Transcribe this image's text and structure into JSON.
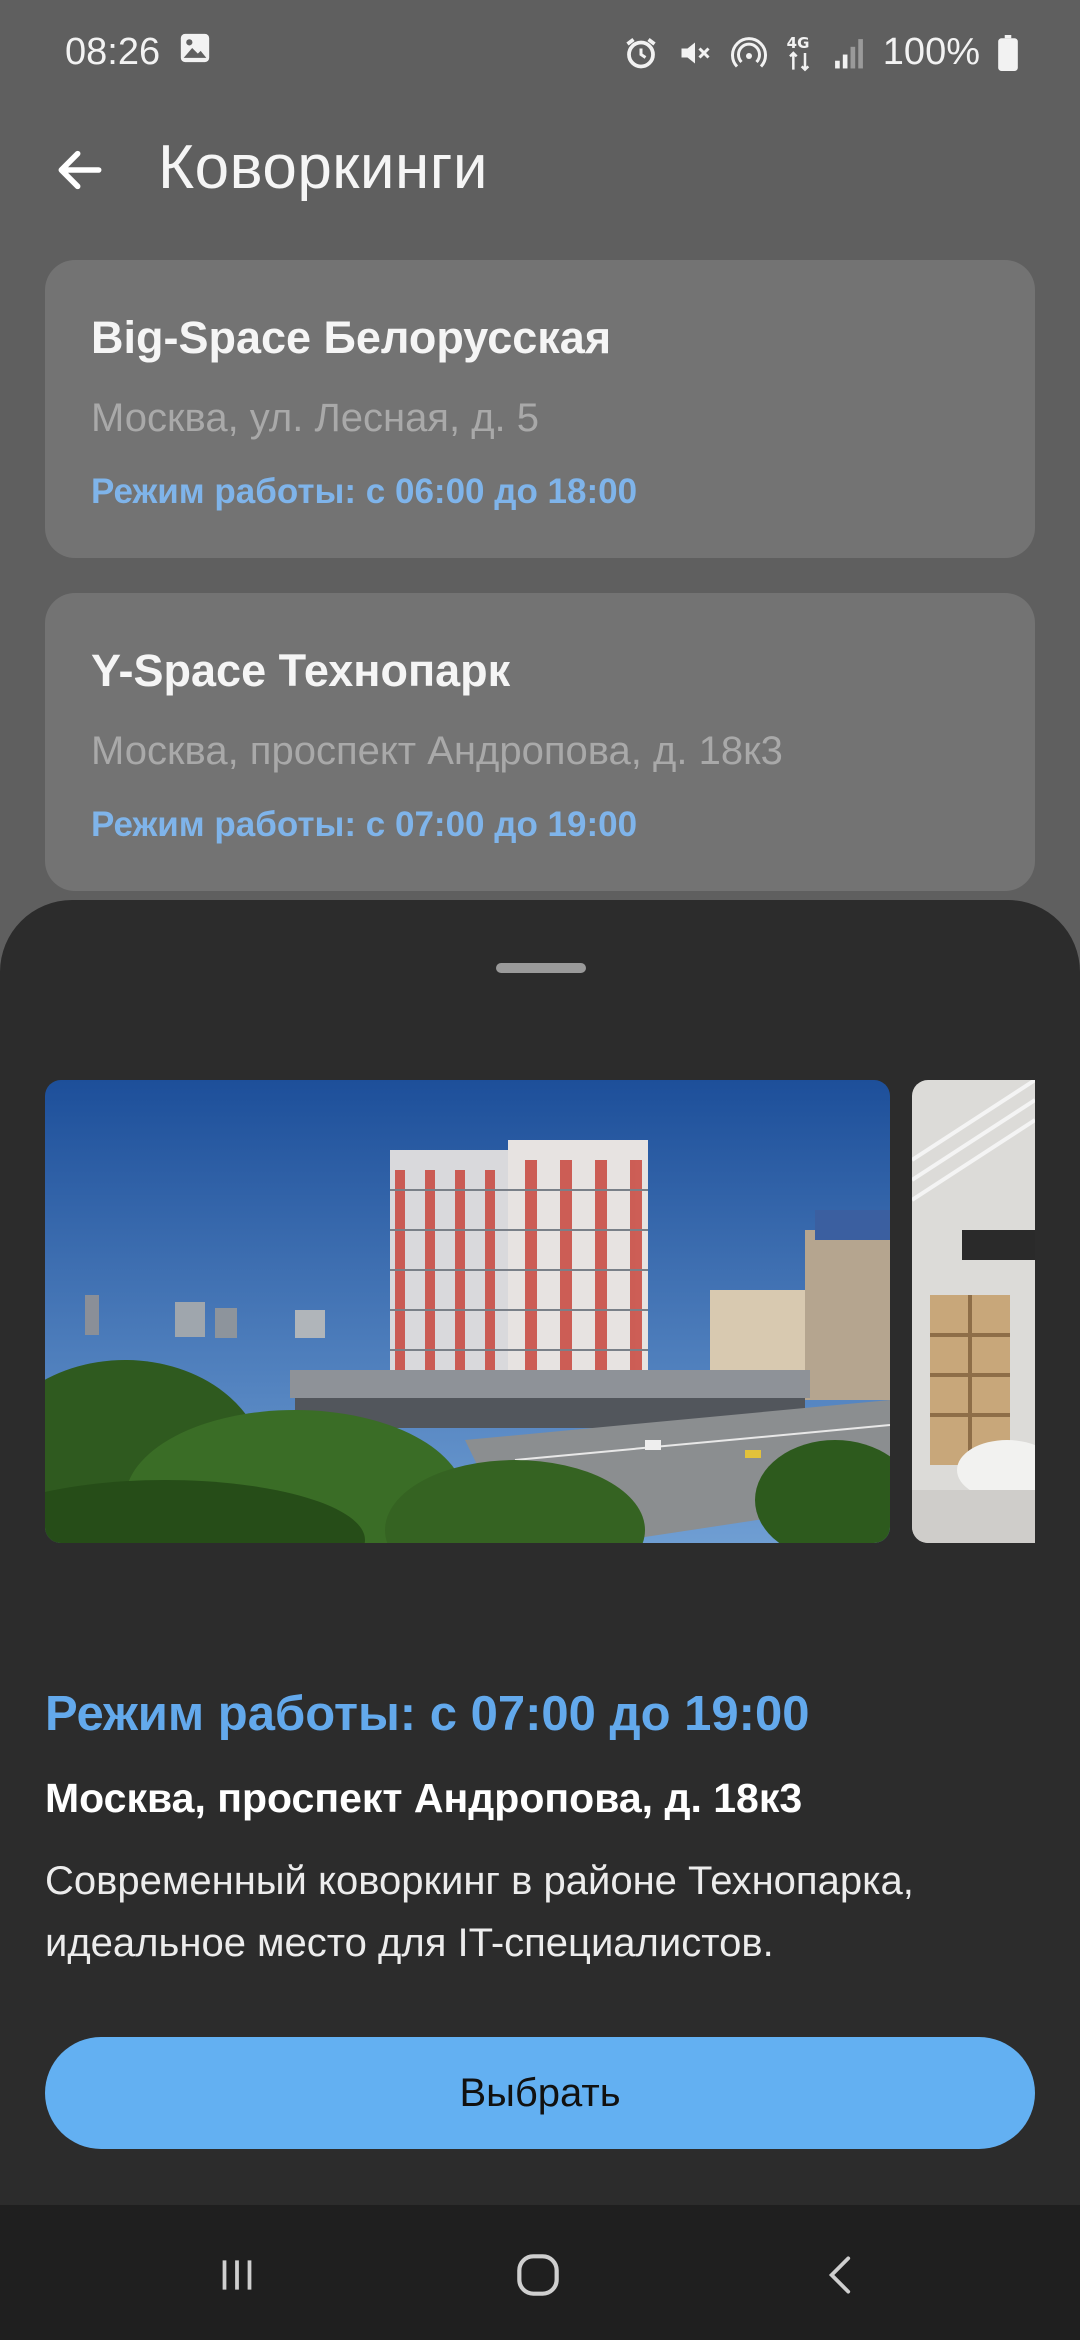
{
  "status_bar": {
    "time": "08:26",
    "battery": "100%",
    "icons": [
      "image-icon",
      "alarm-icon",
      "mute-icon",
      "hotspot-icon",
      "4g-icon",
      "signal-icon",
      "battery-icon"
    ]
  },
  "header": {
    "title": "Коворкинги",
    "back_icon": "arrow-left-icon"
  },
  "coworkings": [
    {
      "name": "Big-Space Белорусская",
      "address": "Москва, ул. Лесная, д. 5",
      "hours": "Режим работы: с 06:00 до 18:00"
    },
    {
      "name": "Y-Space Технопарк",
      "address": "Москва, проспект Андропова, д. 18к3",
      "hours": "Режим работы: с 07:00 до 19:00"
    }
  ],
  "sheet": {
    "hours": "Режим работы: с 07:00 до 19:00",
    "address": "Москва, проспект Андропова, д. 18к3",
    "description": "Современный коворкинг в районе Технопарка, идеальное место для IT-специалистов.",
    "select_label": "Выбрать"
  },
  "colors": {
    "accent": "#63b0f2",
    "hours_text": "#7fb4ea",
    "sheet_bg": "#2c2c2c",
    "card_bg": "#737373"
  },
  "nav": {
    "icons": [
      "recent-apps-icon",
      "home-icon",
      "back-icon"
    ]
  }
}
